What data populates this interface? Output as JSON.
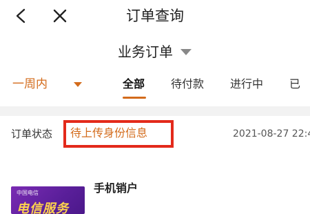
{
  "header": {
    "title": "订单查询",
    "back_icon": "chevron-left-icon",
    "close_icon": "close-icon"
  },
  "business_selector": {
    "label": "业务订单",
    "caret_icon": "caret-down-icon"
  },
  "filters": {
    "period_label": "一周内",
    "period_caret_icon": "caret-down-icon",
    "accent_color": "#d36b1b",
    "tabs": [
      {
        "label": "全部",
        "active": true
      },
      {
        "label": "待付款",
        "active": false
      },
      {
        "label": "进行中",
        "active": false
      },
      {
        "label": "已",
        "active": false
      }
    ]
  },
  "order": {
    "status_label": "订单状态",
    "status_value": "待上传身份信息",
    "highlight_color": "#e32a1b",
    "date": "2021-08-27 22:4",
    "product_name": "手机销户",
    "thumbnail_logo": "中国电信",
    "thumbnail_text": "电信服务"
  }
}
